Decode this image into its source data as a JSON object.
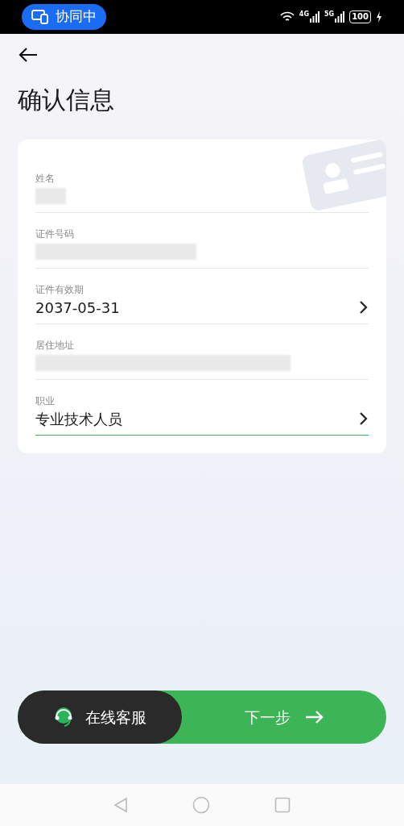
{
  "status_bar": {
    "collab_label": "协同中",
    "signal_labels": [
      "4G",
      "5G"
    ],
    "battery": "100"
  },
  "title": "确认信息",
  "fields": [
    {
      "label": "姓名",
      "kind": "redacted",
      "chevron": false,
      "focused": false
    },
    {
      "label": "证件号码",
      "kind": "redacted",
      "chevron": false,
      "focused": false
    },
    {
      "label": "证件有效期",
      "kind": "text",
      "value": "2037-05-31",
      "chevron": true,
      "focused": false
    },
    {
      "label": "居住地址",
      "kind": "redacted",
      "chevron": false,
      "focused": false
    },
    {
      "label": "职业",
      "kind": "text",
      "value": "专业技术人员",
      "chevron": true,
      "focused": true
    }
  ],
  "support_button": "在线客服",
  "next_button": "下一步"
}
